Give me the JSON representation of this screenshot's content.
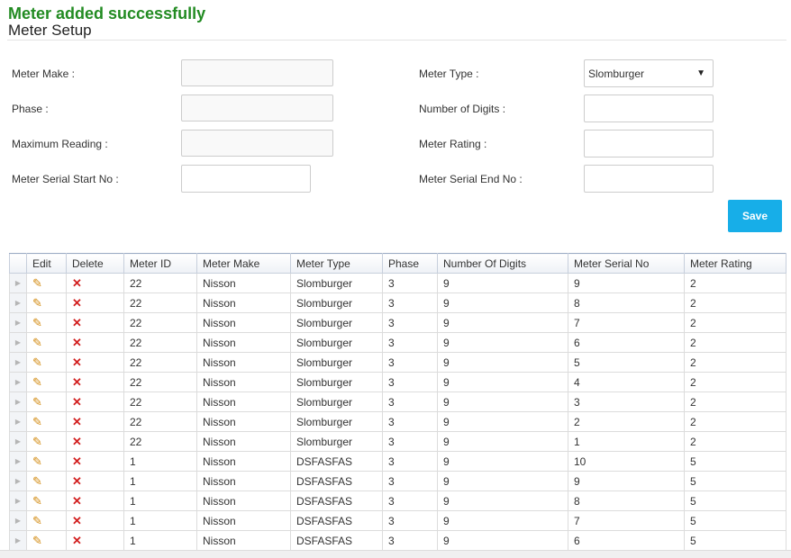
{
  "message": "Meter added successfully",
  "page_title": "Meter Setup",
  "form": {
    "meter_make": {
      "label": "Meter Make :",
      "value": ""
    },
    "phase": {
      "label": "Phase :",
      "value": ""
    },
    "max_reading": {
      "label": "Maximum Reading :",
      "value": ""
    },
    "serial_start": {
      "label": "Meter Serial Start No :",
      "value": ""
    },
    "meter_type": {
      "label": "Meter Type :",
      "value": "Slomburger"
    },
    "num_digits": {
      "label": "Number of Digits :",
      "value": ""
    },
    "meter_rating": {
      "label": "Meter Rating :",
      "value": ""
    },
    "serial_end": {
      "label": "Meter Serial End No :",
      "value": ""
    }
  },
  "save_label": "Save",
  "grid": {
    "columns": [
      "Edit",
      "Delete",
      "Meter ID",
      "Meter Make",
      "Meter Type",
      "Phase",
      "Number Of Digits",
      "Meter Serial No",
      "Meter Rating"
    ],
    "rows": [
      [
        "22",
        "Nisson",
        "Slomburger",
        "3",
        "9",
        "9",
        "2"
      ],
      [
        "22",
        "Nisson",
        "Slomburger",
        "3",
        "9",
        "8",
        "2"
      ],
      [
        "22",
        "Nisson",
        "Slomburger",
        "3",
        "9",
        "7",
        "2"
      ],
      [
        "22",
        "Nisson",
        "Slomburger",
        "3",
        "9",
        "6",
        "2"
      ],
      [
        "22",
        "Nisson",
        "Slomburger",
        "3",
        "9",
        "5",
        "2"
      ],
      [
        "22",
        "Nisson",
        "Slomburger",
        "3",
        "9",
        "4",
        "2"
      ],
      [
        "22",
        "Nisson",
        "Slomburger",
        "3",
        "9",
        "3",
        "2"
      ],
      [
        "22",
        "Nisson",
        "Slomburger",
        "3",
        "9",
        "2",
        "2"
      ],
      [
        "22",
        "Nisson",
        "Slomburger",
        "3",
        "9",
        "1",
        "2"
      ],
      [
        "1",
        "Nisson",
        "DSFASFAS",
        "3",
        "9",
        "10",
        "5"
      ],
      [
        "1",
        "Nisson",
        "DSFASFAS",
        "3",
        "9",
        "9",
        "5"
      ],
      [
        "1",
        "Nisson",
        "DSFASFAS",
        "3",
        "9",
        "8",
        "5"
      ],
      [
        "1",
        "Nisson",
        "DSFASFAS",
        "3",
        "9",
        "7",
        "5"
      ],
      [
        "1",
        "Nisson",
        "DSFASFAS",
        "3",
        "9",
        "6",
        "5"
      ]
    ]
  },
  "icons": {
    "edit": "pencil-icon",
    "delete": "delete-x-icon",
    "expand": "expand-arrow-icon"
  }
}
